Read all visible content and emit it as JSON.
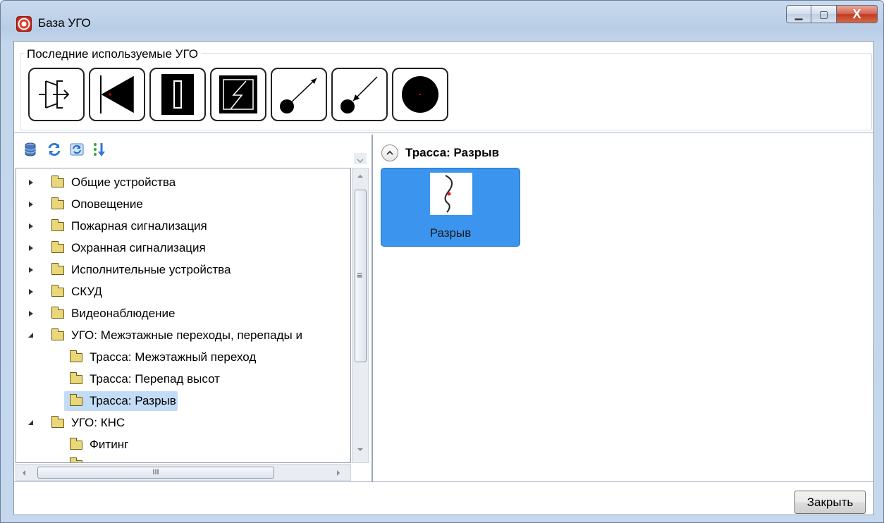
{
  "window": {
    "title": "База УГО",
    "minimize_glyph": "▁",
    "maximize_glyph": "▢",
    "close_glyph": "X"
  },
  "recent": {
    "label": "Последние используемые УГО",
    "items": [
      "door-exit-symbol",
      "triangle-symbol",
      "door-frame-symbol",
      "lightning-symbol",
      "arrow-out-dot-symbol",
      "arrow-in-dot-symbol",
      "filled-circle-symbol"
    ]
  },
  "toolbar": {
    "icons": [
      "database-icon",
      "refresh-icon",
      "sync-icon",
      "sort-icon"
    ]
  },
  "tree": {
    "items": [
      {
        "label": "Общие устройства",
        "state": "collapsed",
        "level": 0
      },
      {
        "label": "Оповещение",
        "state": "collapsed",
        "level": 0
      },
      {
        "label": "Пожарная сигнализация",
        "state": "collapsed",
        "level": 0
      },
      {
        "label": "Охранная сигнализация",
        "state": "collapsed",
        "level": 0
      },
      {
        "label": "Исполнительные устройства",
        "state": "collapsed",
        "level": 0
      },
      {
        "label": "СКУД",
        "state": "collapsed",
        "level": 0
      },
      {
        "label": "Видеонаблюдение",
        "state": "collapsed",
        "level": 0
      },
      {
        "label": "УГО: Межэтажные переходы, перепады и",
        "state": "expanded",
        "level": 0
      },
      {
        "label": "Трасса: Межэтажный переход",
        "state": "leaf",
        "level": 1
      },
      {
        "label": "Трасса: Перепад высот",
        "state": "leaf",
        "level": 1
      },
      {
        "label": "Трасса: Разрыв",
        "state": "leaf",
        "level": 1,
        "selected": true
      },
      {
        "label": "УГО: КНС",
        "state": "expanded",
        "level": 0
      },
      {
        "label": "Фитинг",
        "state": "leaf",
        "level": 1
      }
    ]
  },
  "scrollbar": {
    "h_grip": "III",
    "v_grip": "≡"
  },
  "content": {
    "group_title": "Трасса: Разрыв",
    "cards": [
      {
        "label": "Разрыв",
        "selected": true
      }
    ]
  },
  "footer": {
    "close_label": "Закрыть"
  },
  "colors": {
    "selection": "#3b95ee",
    "tree_selection": "#c3dcf6",
    "folder": "#e9d779"
  }
}
